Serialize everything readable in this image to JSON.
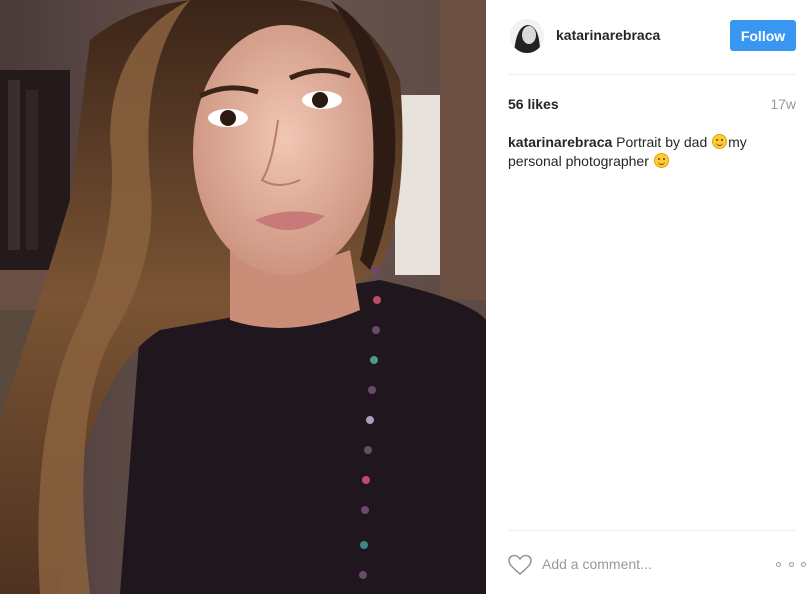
{
  "post": {
    "photo_description_icon": "portrait-photo",
    "author": {
      "username": "katarinarebraca",
      "avatar_icon": "profile-avatar"
    },
    "follow_label": "Follow",
    "likes": "56 likes",
    "age": "17w",
    "caption": {
      "username": "katarinarebraca",
      "text_part1": " Portrait by dad ",
      "text_part2": "my personal photographer ",
      "emoji_icon": "smiling-face-emoji"
    },
    "comment_placeholder": "Add a comment...",
    "like_icon": "heart-icon",
    "more_icon": "ellipsis-icon"
  },
  "colors": {
    "accent": "#3897f0",
    "secondary_text": "#999999",
    "primary_text": "#262626",
    "divider": "#efefef"
  }
}
